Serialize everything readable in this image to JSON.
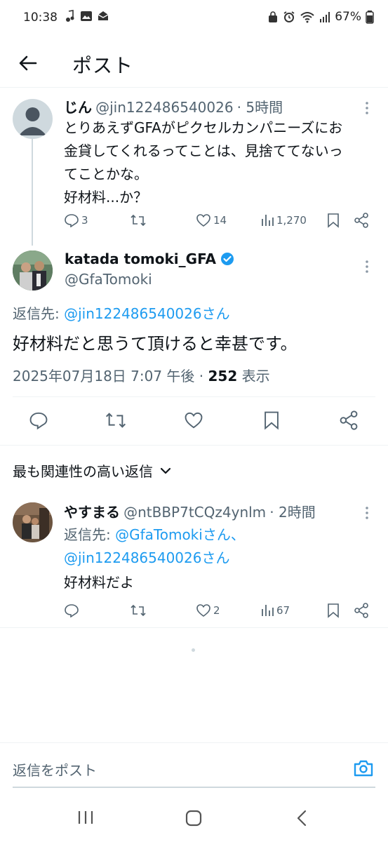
{
  "status": {
    "time": "10:38",
    "battery": "67%"
  },
  "header": {
    "title": "ポスト"
  },
  "parent": {
    "name": "じん",
    "handle": "@jin122486540026",
    "time": "· 5時間",
    "lines": [
      "とりあえずGFAがピクセルカンパニーズにお",
      "金貸してくれるってことは、見捨ててないっ",
      "てことかな。",
      "好材料...か？"
    ],
    "replies": "3",
    "likes": "14",
    "views": "1,270"
  },
  "main": {
    "name": "katada tomoki_GFA",
    "handle": "@GfaTomoki",
    "reply_to_prefix": "返信先: ",
    "reply_to_user": "@jin122486540026さん",
    "text": "好材料だと思うて頂けると幸甚です。",
    "date": "2025年07月18日 7:07 午後 · ",
    "view_count": "252",
    "view_label": " 表示"
  },
  "sort": {
    "label": "最も関連性の高い返信"
  },
  "reply": {
    "name": "やすまる",
    "handle": "@ntBBP7tCQz4ynlm",
    "time": "· 2時間",
    "reply_to_prefix": "返信先: ",
    "reply_to_user1": "@GfaTomokiさん、",
    "reply_to_user2": "@jin122486540026さん",
    "text": "好材料だよ",
    "likes": "2",
    "views": "67"
  },
  "compose": {
    "placeholder": "返信をポスト"
  },
  "colors": {
    "accent": "#1d9bf0",
    "muted": "#536471",
    "verified": "#1d9bf0"
  }
}
